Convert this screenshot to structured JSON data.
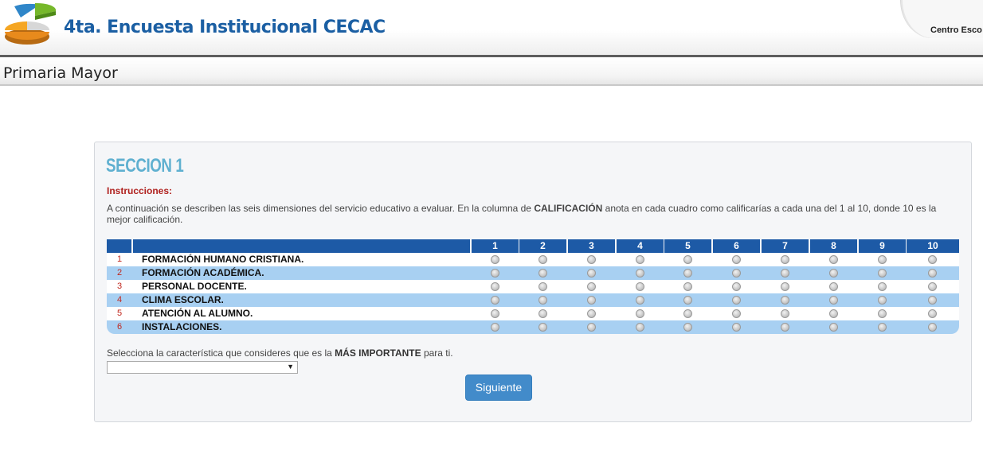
{
  "header": {
    "title": "4ta. Encuesta Institucional CECAC",
    "right_text": "Centro Esco"
  },
  "subheader": {
    "title": "Primaria Mayor"
  },
  "section": {
    "title": "SECCION 1",
    "instructions_label": "Instrucciones:",
    "instructions_pre": "A continuación se describen las seis dimensiones del servicio educativo a evaluar. En la columna de ",
    "instructions_bold": "CALIFICACIÓN",
    "instructions_post": " anota en cada cuadro como calificarías a cada una del 1 al 10, donde 10 es la mejor calificación."
  },
  "table": {
    "score_headers": [
      "1",
      "2",
      "3",
      "4",
      "5",
      "6",
      "7",
      "8",
      "9",
      "10"
    ],
    "rows": [
      {
        "num": "1",
        "label": "FORMACIÓN HUMANO CRISTIANA."
      },
      {
        "num": "2",
        "label": "FORMACIÓN ACADÉMICA."
      },
      {
        "num": "3",
        "label": "PERSONAL DOCENTE."
      },
      {
        "num": "4",
        "label": "CLIMA ESCOLAR."
      },
      {
        "num": "5",
        "label": "ATENCIÓN AL ALUMNO."
      },
      {
        "num": "6",
        "label": "INSTALACIONES."
      }
    ]
  },
  "question": {
    "pre": "Selecciona la característica que consideres que es la ",
    "bold": "MÁS IMPORTANTE",
    "post": " para ti.",
    "selected": ""
  },
  "button": {
    "label": "Siguiente"
  },
  "colors": {
    "accent": "#1b5fa3",
    "header_blue": "#1d5aa6",
    "row_blue": "#a8d0f2",
    "section_title": "#5fb0d0",
    "instr_red": "#b0211e",
    "button": "#428bca"
  }
}
